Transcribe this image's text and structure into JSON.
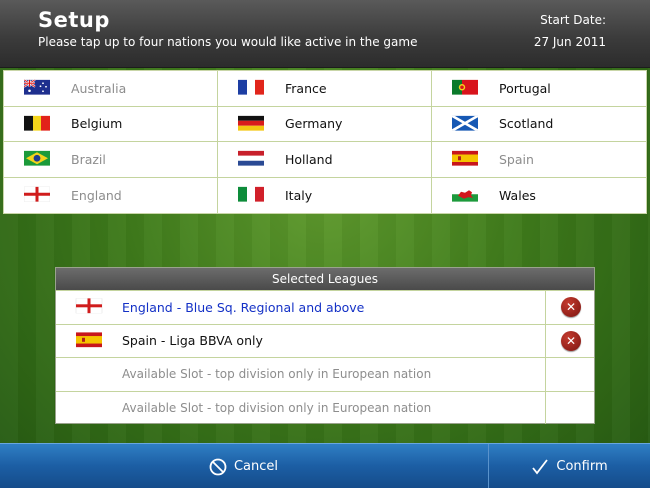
{
  "header": {
    "title": "Setup",
    "subtitle": "Please tap up to four nations you would like active in the game",
    "date_label": "Start Date:",
    "date_value": "27 Jun 2011"
  },
  "nations": [
    {
      "name": "Australia",
      "flag": "australia-flag",
      "active": false
    },
    {
      "name": "France",
      "flag": "france-flag",
      "active": true
    },
    {
      "name": "Portugal",
      "flag": "portugal-flag",
      "active": true
    },
    {
      "name": "Belgium",
      "flag": "belgium-flag",
      "active": true
    },
    {
      "name": "Germany",
      "flag": "germany-flag",
      "active": true
    },
    {
      "name": "Scotland",
      "flag": "scotland-flag",
      "active": true
    },
    {
      "name": "Brazil",
      "flag": "brazil-flag",
      "active": false
    },
    {
      "name": "Holland",
      "flag": "holland-flag",
      "active": true
    },
    {
      "name": "Spain",
      "flag": "spain-flag",
      "active": false
    },
    {
      "name": "England",
      "flag": "england-flag",
      "active": false
    },
    {
      "name": "Italy",
      "flag": "italy-flag",
      "active": true
    },
    {
      "name": "Wales",
      "flag": "wales-flag",
      "active": true
    }
  ],
  "leagues": {
    "title": "Selected Leagues",
    "rows": [
      {
        "text": "England - Blue Sq. Regional and above",
        "flag": "england-flag",
        "removable": true
      },
      {
        "text": "Spain - Liga BBVA only",
        "flag": "spain-flag",
        "removable": true
      },
      {
        "text": "Available Slot - top division only in European nation",
        "flag": "",
        "removable": false
      },
      {
        "text": "Available Slot - top division only in European nation",
        "flag": "",
        "removable": false
      }
    ]
  },
  "footer": {
    "cancel_label": "Cancel",
    "confirm_label": "Confirm"
  },
  "colors": {
    "header": "#3c3c3c",
    "grass": "#3e7a1b",
    "footer": "#1c5ea4",
    "link": "#1431c6",
    "inactive_text": "#8d8d8d",
    "remove_button": "#a52a22"
  }
}
